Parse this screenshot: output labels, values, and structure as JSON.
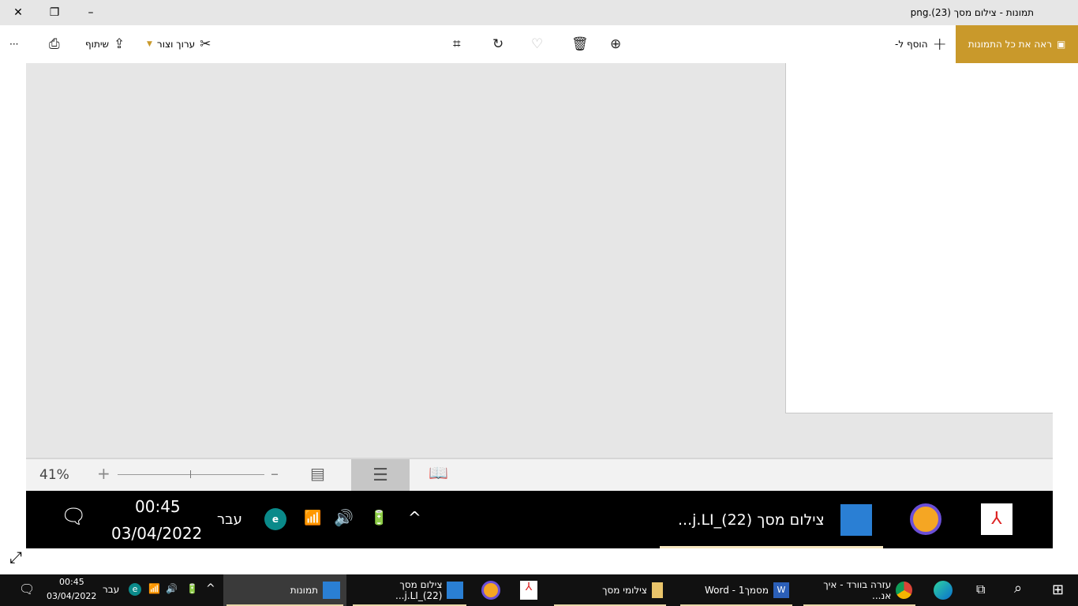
{
  "window": {
    "title": "תמונות - צילום מסך (23).png",
    "close": "✕",
    "restore": "❐",
    "minimize": "–"
  },
  "toolbar": {
    "see_all": "ראה את כל התמונות",
    "add_to": "הוסף ל-",
    "edit_create": "ערוך וצור",
    "share": "שיתוף",
    "more": "···"
  },
  "viewer": {
    "zoom_level": "41%",
    "zoom_in": "+",
    "zoom_out": "–"
  },
  "inner_taskbar": {
    "time": "00:45",
    "date": "03/04/2022",
    "language": "עבר",
    "app_label": "צילום מסך (22)_j.LI..."
  },
  "taskbar": {
    "time": "00:45",
    "date": "03/04/2022",
    "language": "עבר",
    "apps": [
      {
        "label": "תמונות"
      },
      {
        "label": "צילום מסך (22)_j.LI..."
      },
      {
        "label": "צילומי מסך"
      },
      {
        "label": "מסמך1 - Word"
      },
      {
        "label": "עזרה בוורד - איך אנ..."
      }
    ]
  }
}
